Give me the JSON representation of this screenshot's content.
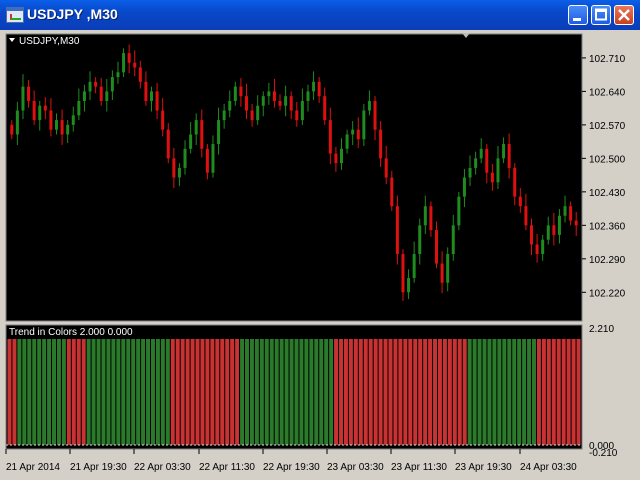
{
  "window": {
    "title": "USDJPY ,M30"
  },
  "chart": {
    "symbol_label": "USDJPY,M30",
    "indicator_label": "Trend in Colors 2.000 0.000",
    "colors": {
      "background": "#000000",
      "bull": "#1e8c1e",
      "bear": "#e01010",
      "axis": "#000000",
      "panel_frame": "#808080",
      "ind_green": "#2b7a2b",
      "ind_red": "#c83232"
    }
  },
  "chart_data": [
    {
      "type": "candlestick",
      "title": "USDJPY,M30",
      "y_ticks": [
        "102.710",
        "102.640",
        "102.570",
        "102.500",
        "102.430",
        "102.360",
        "102.290",
        "102.220"
      ],
      "ylim": [
        102.16,
        102.76
      ],
      "x_ticks": [
        "21 Apr 2014",
        "21 Apr 19:30",
        "22 Apr 03:30",
        "22 Apr 11:30",
        "22 Apr 19:30",
        "23 Apr 03:30",
        "23 Apr 11:30",
        "23 Apr 19:30",
        "24 Apr 03:30"
      ],
      "closes": [
        102.55,
        102.6,
        102.65,
        102.62,
        102.58,
        102.61,
        102.6,
        102.56,
        102.58,
        102.55,
        102.57,
        102.59,
        102.62,
        102.64,
        102.66,
        102.65,
        102.62,
        102.64,
        102.67,
        102.68,
        102.72,
        102.7,
        102.69,
        102.66,
        102.62,
        102.64,
        102.6,
        102.56,
        102.5,
        102.46,
        102.48,
        102.52,
        102.55,
        102.58,
        102.52,
        102.47,
        102.53,
        102.58,
        102.6,
        102.62,
        102.65,
        102.63,
        102.6,
        102.58,
        102.61,
        102.63,
        102.64,
        102.62,
        102.61,
        102.63,
        102.6,
        102.58,
        102.62,
        102.64,
        102.66,
        102.63,
        102.58,
        102.51,
        102.49,
        102.52,
        102.55,
        102.56,
        102.54,
        102.6,
        102.62,
        102.56,
        102.5,
        102.46,
        102.4,
        102.3,
        102.22,
        102.25,
        102.3,
        102.36,
        102.4,
        102.35,
        102.28,
        102.24,
        102.3,
        102.36,
        102.42,
        102.46,
        102.48,
        102.5,
        102.52,
        102.47,
        102.45,
        102.5,
        102.53,
        102.48,
        102.42,
        102.4,
        102.36,
        102.32,
        102.3,
        102.33,
        102.36,
        102.34,
        102.38,
        102.4,
        102.37,
        102.36
      ],
      "indicator": {
        "type": "bar",
        "ylim": [
          -0.21,
          2.21
        ],
        "y_ticks": [
          "2.210",
          "0.000",
          "-0.210"
        ],
        "segments": [
          {
            "color": "red",
            "length": 2
          },
          {
            "color": "green",
            "length": 10
          },
          {
            "color": "red",
            "length": 4
          },
          {
            "color": "green",
            "length": 17
          },
          {
            "color": "red",
            "length": 14
          },
          {
            "color": "green",
            "length": 19
          },
          {
            "color": "red",
            "length": 27
          },
          {
            "color": "green",
            "length": 14
          },
          {
            "color": "red",
            "length": 9
          }
        ]
      }
    }
  ]
}
